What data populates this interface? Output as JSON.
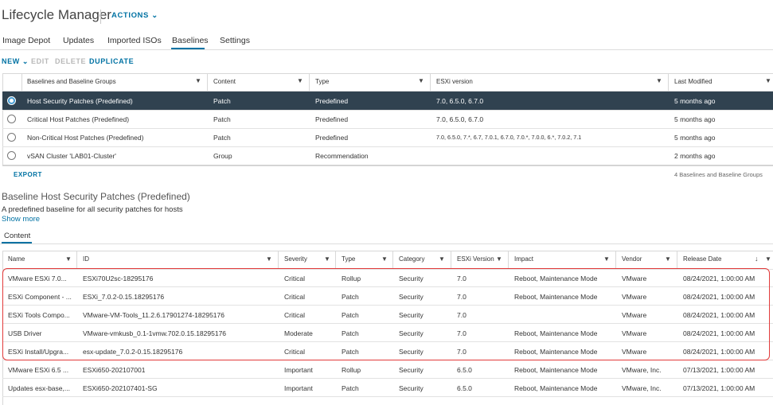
{
  "header": {
    "title": "Lifecycle Manager",
    "actions_label": "ACTIONS",
    "actions_caret": "⌄"
  },
  "tabs": [
    {
      "label": "Image Depot"
    },
    {
      "label": "Updates"
    },
    {
      "label": "Imported ISOs"
    },
    {
      "label": "Baselines",
      "active": true
    },
    {
      "label": "Settings"
    }
  ],
  "toolbar": {
    "new_label": "NEW",
    "new_caret": "⌄",
    "edit_label": "EDIT",
    "delete_label": "DELETE",
    "duplicate_label": "DUPLICATE"
  },
  "filter_icon": "filter-icon",
  "sort_icon": "sort-desc-icon",
  "baselines_table": {
    "columns": [
      "Baselines and Baseline Groups",
      "Content",
      "Type",
      "ESXi version",
      "Last Modified"
    ],
    "rows": [
      {
        "selected": true,
        "cells": [
          "Host Security Patches (Predefined)",
          "Patch",
          "Predefined",
          "7.0, 6.5.0, 6.7.0",
          "5 months ago"
        ]
      },
      {
        "selected": false,
        "cells": [
          "Critical Host Patches (Predefined)",
          "Patch",
          "Predefined",
          "7.0, 6.5.0, 6.7.0",
          "5 months ago"
        ]
      },
      {
        "selected": false,
        "cells": [
          "Non-Critical Host Patches (Predefined)",
          "Patch",
          "Predefined",
          "7.0, 6.5.0, 7.*, 6.7, 7.0.1, 6.7.0, 7.0.*, 7.0.0, 6.*, 7.0.2, 7.1",
          "5 months ago"
        ]
      },
      {
        "selected": false,
        "cells": [
          "vSAN Cluster 'LAB01-Cluster'",
          "Group",
          "Recommendation",
          "",
          "2 months ago"
        ]
      }
    ],
    "export_label": "EXPORT",
    "count_label": "4 Baselines and Baseline Groups"
  },
  "detail": {
    "title": "Baseline Host Security Patches (Predefined)",
    "description": "A predefined baseline for all security patches for hosts",
    "show_more": "Show more",
    "content_tab": "Content"
  },
  "content_table": {
    "columns": [
      "Name",
      "ID",
      "Severity",
      "Type",
      "Category",
      "ESXi Version",
      "Impact",
      "Vendor",
      "Release Date"
    ],
    "rows": [
      [
        "VMware ESXi 7.0...",
        "ESXi70U2sc-18295176",
        "Critical",
        "Rollup",
        "Security",
        "7.0",
        "Reboot, Maintenance Mode",
        "VMware",
        "08/24/2021, 1:00:00 AM"
      ],
      [
        "ESXi Component - ...",
        "ESXi_7.0.2-0.15.18295176",
        "Critical",
        "Patch",
        "Security",
        "7.0",
        "Reboot, Maintenance Mode",
        "VMware",
        "08/24/2021, 1:00:00 AM"
      ],
      [
        "ESXi Tools Compo...",
        "VMware-VM-Tools_11.2.6.17901274-18295176",
        "Critical",
        "Patch",
        "Security",
        "7.0",
        "",
        "VMware",
        "08/24/2021, 1:00:00 AM"
      ],
      [
        "USB Driver",
        "VMware-vmkusb_0.1-1vmw.702.0.15.18295176",
        "Moderate",
        "Patch",
        "Security",
        "7.0",
        "Reboot, Maintenance Mode",
        "VMware",
        "08/24/2021, 1:00:00 AM"
      ],
      [
        "ESXi Install/Upgra...",
        "esx-update_7.0.2-0.15.18295176",
        "Critical",
        "Patch",
        "Security",
        "7.0",
        "Reboot, Maintenance Mode",
        "VMware",
        "08/24/2021, 1:00:00 AM"
      ],
      [
        "VMware ESXi 6.5 ...",
        "ESXi650-202107001",
        "Important",
        "Rollup",
        "Security",
        "6.5.0",
        "Reboot, Maintenance Mode",
        "VMware, Inc.",
        "07/13/2021, 1:00:00 AM"
      ],
      [
        "Updates esx-base,...",
        "ESXi650-202107401-SG",
        "Important",
        "Patch",
        "Security",
        "6.5.0",
        "Reboot, Maintenance Mode",
        "VMware, Inc.",
        "07/13/2021, 1:00:00 AM"
      ]
    ]
  },
  "colors": {
    "accent": "#0072a3",
    "selected_row": "#304250",
    "highlight_box": "#e23b3b"
  }
}
